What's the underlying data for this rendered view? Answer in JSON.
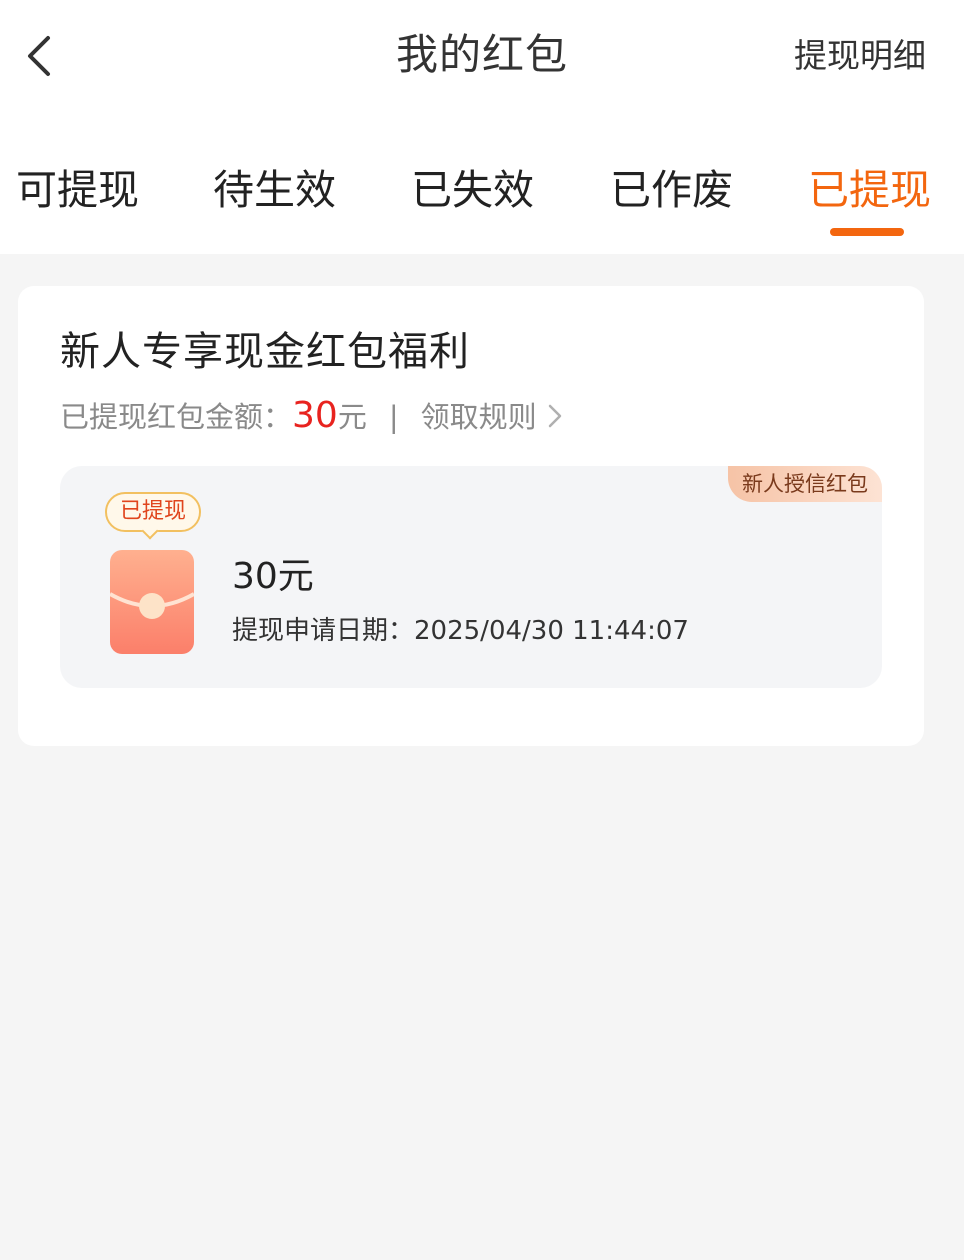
{
  "header": {
    "title": "我的红包",
    "detail_link": "提现明细"
  },
  "tabs": [
    {
      "label": "可提现",
      "active": false
    },
    {
      "label": "待生效",
      "active": false
    },
    {
      "label": "已失效",
      "active": false
    },
    {
      "label": "已作废",
      "active": false
    },
    {
      "label": "已提现",
      "active": true
    }
  ],
  "card": {
    "title": "新人专享现金红包福利",
    "summary_label": "已提现红包金额：",
    "summary_amount": "30",
    "summary_unit": "元",
    "separator": "|",
    "rules_link": "领取规则",
    "item": {
      "corner_badge": "新人授信红包",
      "status": "已提现",
      "amount": "30元",
      "date_label": "提现申请日期：",
      "date_value": "2025/04/30 11:44:07"
    }
  },
  "colors": {
    "accent": "#f3660f",
    "amount_red": "#e8231f",
    "background": "#f5f5f5"
  },
  "icons": {
    "back": "chevron-left-icon",
    "rules_arrow": "chevron-right-icon",
    "envelope": "red-envelope-icon"
  }
}
